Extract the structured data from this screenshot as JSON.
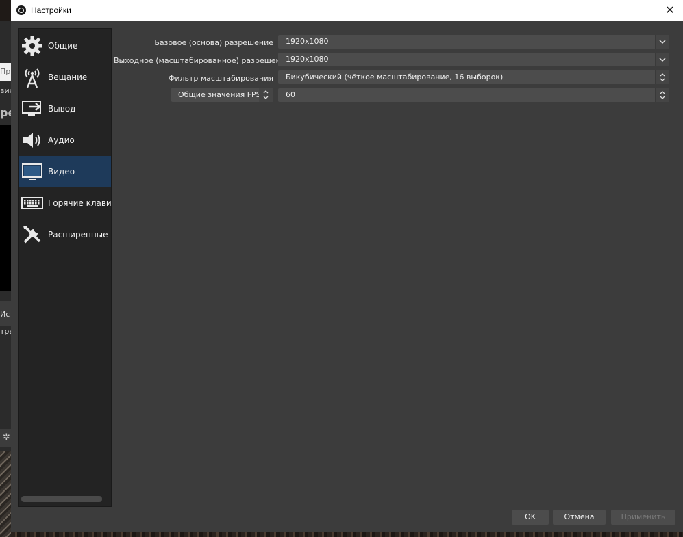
{
  "background": {
    "fragments": [
      "Пр",
      "вил",
      "ре",
      "Ис",
      "тры"
    ]
  },
  "dialog": {
    "title": "Настройки",
    "close_glyph": "✕"
  },
  "sidebar": {
    "items": [
      {
        "label": "Общие",
        "icon": "gear-icon",
        "active": false
      },
      {
        "label": "Вещание",
        "icon": "broadcast-antenna-icon",
        "active": false
      },
      {
        "label": "Вывод",
        "icon": "output-monitor-icon",
        "active": false
      },
      {
        "label": "Аудио",
        "icon": "speaker-icon",
        "active": false
      },
      {
        "label": "Видео",
        "icon": "monitor-icon",
        "active": true
      },
      {
        "label": "Горячие клавиши",
        "icon": "keyboard-icon",
        "active": false
      },
      {
        "label": "Расширенные",
        "icon": "tools-icon",
        "active": false
      }
    ]
  },
  "video": {
    "base_resolution_label": "Базовое (основа) разрешение",
    "base_resolution_value": "1920x1080",
    "output_resolution_label": "Выходное (масштабированное) разрешение",
    "output_resolution_value": "1920x1080",
    "downscale_filter_label": "Фильтр масштабирования",
    "downscale_filter_value": "Бикубический (чёткое масштабирование, 16 выборок)",
    "fps_mode_value": "Общие значения FPS",
    "fps_value": "60"
  },
  "buttons": {
    "ok": "OK",
    "cancel": "Отмена",
    "apply": "Применить"
  },
  "colors": {
    "dialog_bg": "#3c3c3c",
    "sidebar_bg": "#232323",
    "active_item": "#1e3a5a",
    "field_bg": "#4c4c4c"
  }
}
